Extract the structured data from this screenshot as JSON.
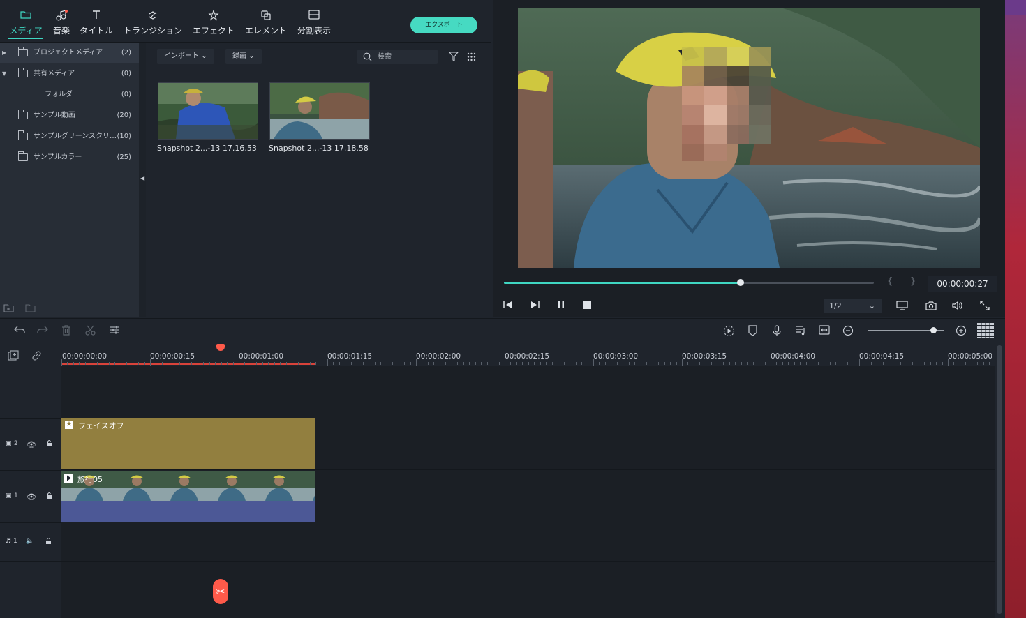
{
  "toolbar": {
    "tabs": [
      {
        "label": "メディア",
        "icon": "folder-icon",
        "active": true
      },
      {
        "label": "音楽",
        "icon": "music-note-icon"
      },
      {
        "label": "タイトル",
        "icon": "text-t-icon"
      },
      {
        "label": "トランジション",
        "icon": "transition-icon"
      },
      {
        "label": "エフェクト",
        "icon": "effects-icon"
      },
      {
        "label": "エレメント",
        "icon": "elements-icon"
      },
      {
        "label": "分割表示",
        "icon": "split-screen-icon"
      }
    ],
    "export_label": "エクスポート",
    "accent": "#3fd6c2"
  },
  "folders": [
    {
      "name": "プロジェクトメディア",
      "count": "(2)"
    },
    {
      "name": "共有メディア",
      "count": "(0)"
    },
    {
      "name": "フォルダ",
      "count": "(0)"
    },
    {
      "name": "サンプル動画",
      "count": "(20)"
    },
    {
      "name": "サンプルグリーンスクリ…",
      "count": "(10)"
    },
    {
      "name": "サンプルカラー",
      "count": "(25)"
    }
  ],
  "media": {
    "import_label": "インポート",
    "record_label": "録画",
    "search_placeholder": "検索",
    "items": [
      {
        "label": "Snapshot 2...-13 17.16.53"
      },
      {
        "label": "Snapshot 2...-13 17.18.58"
      }
    ]
  },
  "preview": {
    "timecode": "00:00:00:27",
    "ratio": "1/2",
    "progress": 0.64
  },
  "timeline": {
    "ruler": [
      "00:00:00:00",
      "00:00:00:15",
      "00:00:01:00",
      "00:00:01:15",
      "00:00:02:00",
      "00:00:02:15",
      "00:00:03:00",
      "00:00:03:15",
      "00:00:04:00",
      "00:00:04:15",
      "00:00:05:00"
    ],
    "tracks": [
      {
        "label": "2",
        "type": "video"
      },
      {
        "label": "1",
        "type": "video"
      },
      {
        "label": "1",
        "type": "audio"
      }
    ],
    "clips": {
      "face_off": "フェイスオフ",
      "video": "旅行05"
    },
    "playhead_color": "#ff5a4a"
  }
}
